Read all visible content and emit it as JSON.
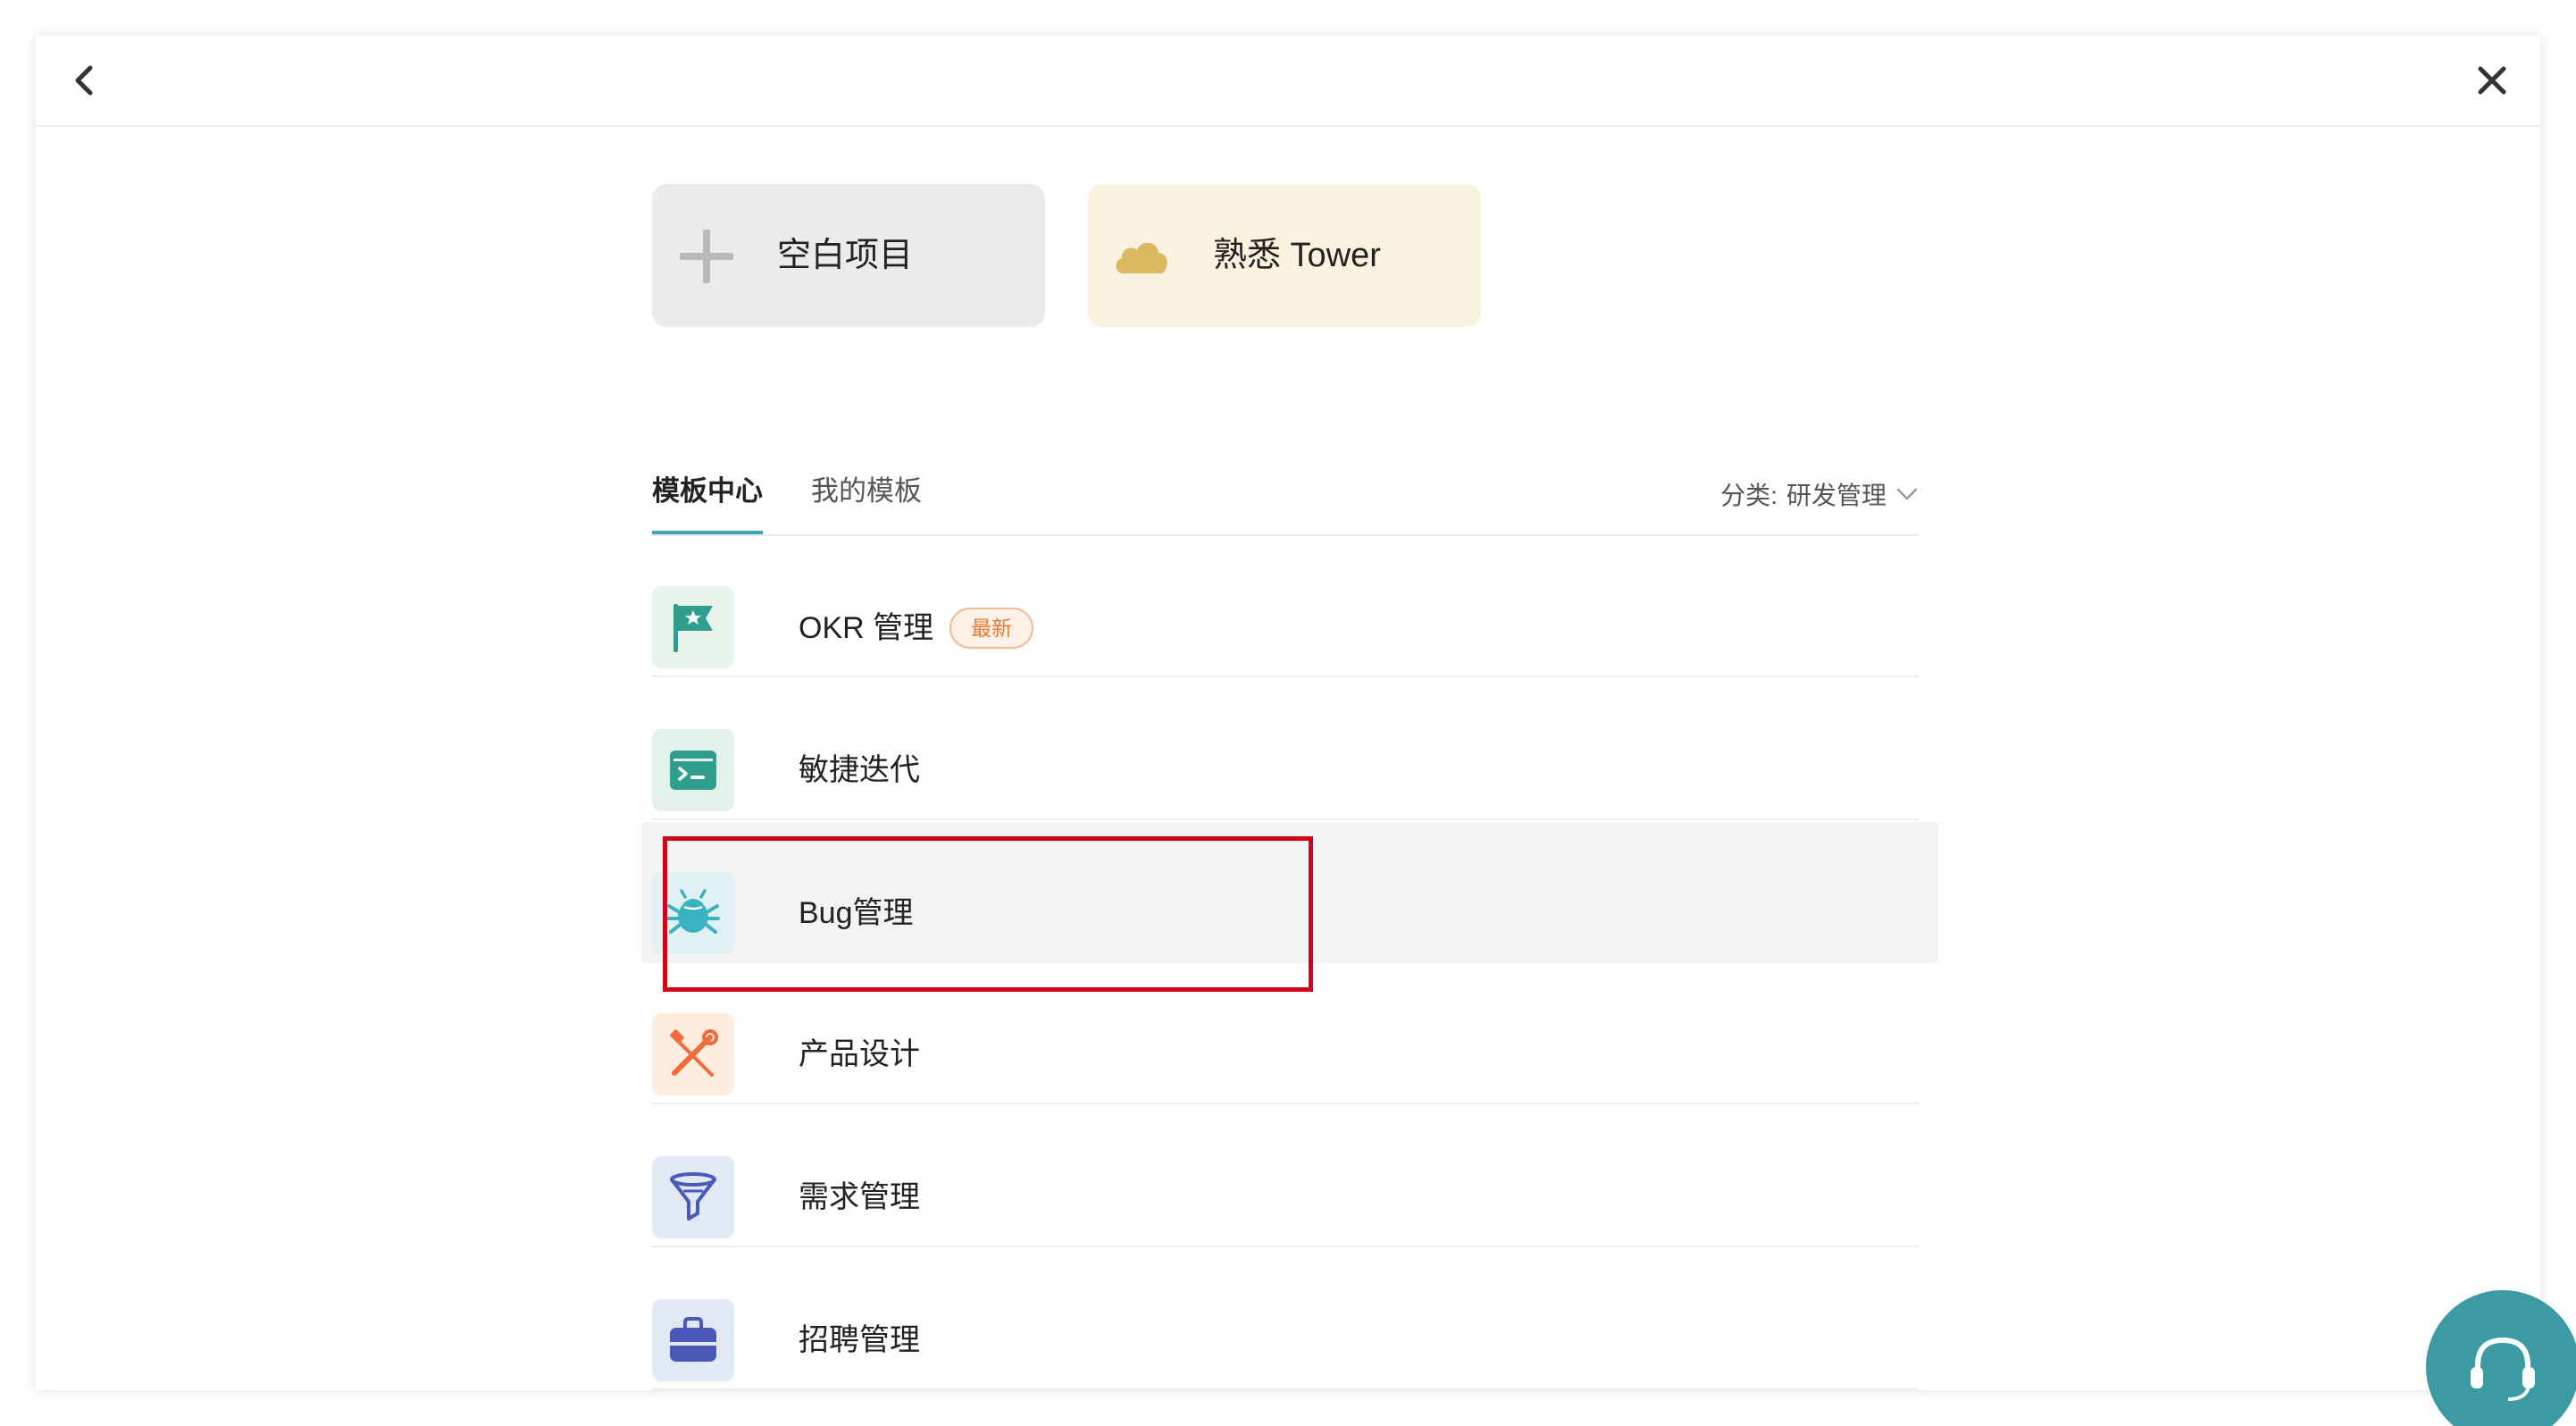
{
  "header": {
    "back_icon": "chevron-left-icon",
    "close_icon": "close-icon"
  },
  "quick_cards": [
    {
      "label": "空白项目",
      "icon": "plus-icon",
      "color": "#ebebeb"
    },
    {
      "label": "熟悉 Tower",
      "icon": "cloud-icon",
      "color": "#f8f2de"
    }
  ],
  "tabs": [
    {
      "label": "模板中心",
      "active": true
    },
    {
      "label": "我的模板",
      "active": false
    }
  ],
  "category": {
    "prefix": "分类:",
    "value": "研发管理"
  },
  "templates": [
    {
      "label": "OKR 管理",
      "badge": "最新",
      "icon": "flag-star-icon",
      "color": "#2f9e8f"
    },
    {
      "label": "敏捷迭代",
      "icon": "terminal-icon",
      "color": "#2f9e8f"
    },
    {
      "label": "Bug管理",
      "icon": "bug-icon",
      "color": "#3ab3c0"
    },
    {
      "label": "产品设计",
      "icon": "design-tools-icon",
      "color": "#f06c3b"
    },
    {
      "label": "需求管理",
      "icon": "funnel-icon",
      "color": "#4a5ab8"
    },
    {
      "label": "招聘管理",
      "icon": "briefcase-icon",
      "color": "#4a5ab8"
    }
  ],
  "support": {
    "icon": "headset-icon"
  }
}
